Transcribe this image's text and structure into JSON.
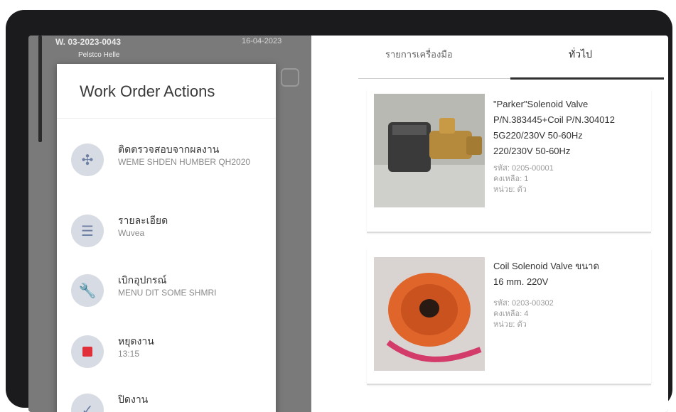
{
  "background_header": {
    "work_order_label": "W. 03-2023-0043",
    "requester_label": "Pelstco Helle",
    "date_label": "16-04-2023"
  },
  "sheet": {
    "title": "Work Order Actions",
    "actions": [
      {
        "title": "ติดตรวจสอบจากผลงาน",
        "subtitle": "WEME SHDEN HUMBER QH2020",
        "icon": "tools-icon"
      },
      {
        "title": "รายละเอียด",
        "subtitle": "Wuvea",
        "icon": "document-icon"
      },
      {
        "title": "เบิกอุปกรณ์",
        "subtitle": "MENU DIT SOME SHMRI",
        "icon": "wrench-icon"
      },
      {
        "title": "หยุดงาน",
        "subtitle": "13:15",
        "icon": "stop-icon"
      },
      {
        "title": "ปิดงาน",
        "subtitle": "",
        "icon": "check-icon"
      }
    ]
  },
  "tabs": {
    "left_label": "รายการเครื่องมือ",
    "right_label": "ทั่วไป"
  },
  "products": [
    {
      "name_lines": [
        "\"Parker\"Solenoid Valve",
        "P/N.383445+Coil P/N.304012",
        "5G220/230V 50-60Hz",
        "220/230V 50-60Hz"
      ],
      "meta_lines": [
        "รหัส: 0205-00001",
        "คงเหลือ: 1",
        "หน่วย: ตัว"
      ]
    },
    {
      "name_lines": [
        "Coil Solenoid Valve ขนาด",
        "16 mm. 220V"
      ],
      "meta_lines": [
        "รหัส: 0203-00302",
        "คงเหลือ: 4",
        "หน่วย: ตัว"
      ]
    }
  ]
}
